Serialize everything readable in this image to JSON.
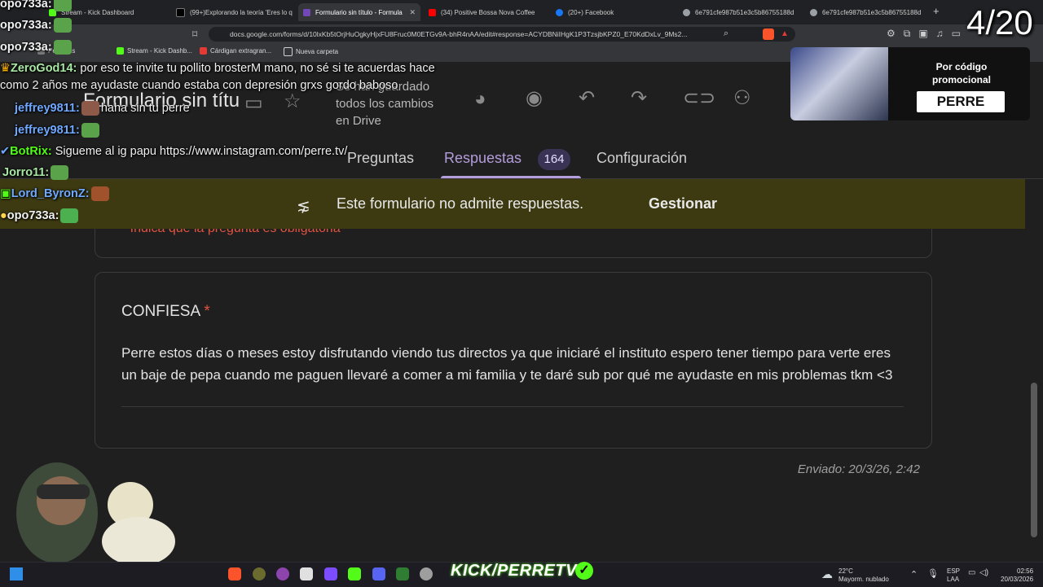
{
  "browser": {
    "tabs": [
      {
        "title": "Stream - Kick Dashboard",
        "color": "#53fc18"
      },
      {
        "title": "(99+)Explorando la teoría 'Eres lo q",
        "color": "#000000"
      },
      {
        "title": "Formulario sin título - Formula",
        "color": "#7248b9",
        "active": true
      },
      {
        "title": "(34) Positive Bossa Nova Coffee",
        "color": "#ff0000"
      },
      {
        "title": "(20+) Facebook",
        "color": "#1877f2"
      },
      {
        "title": "6e791cfe987b51e3c5b86755188d",
        "color": "#9aa0a6"
      },
      {
        "title": "6e791cfe987b51e3c5b86755188d",
        "color": "#9aa0a6"
      }
    ],
    "url": "docs.google.com/forms/d/10lxKb5tOrjHuOgkyHjxFU8Fruc0M0ETGv9A-bhR4nAA/edit#response=ACYDBNiIHgK1P3TzsjbKPZ0_E70KdDxLv_9Ms2...",
    "bookmarks": [
      {
        "label": "Perrexiss",
        "color": "#7a7a7a"
      },
      {
        "label": "Stream - Kick Dashb...",
        "color": "#53fc18"
      },
      {
        "label": "Cárdigan extragran...",
        "color": "#e53935"
      },
      {
        "label": "Nueva carpeta",
        "color": "#cfcfcf"
      }
    ]
  },
  "form": {
    "title": "Formulario sin títu",
    "save_status": "Se han guardado todos los cambios en Drive",
    "tabs": {
      "questions": "Preguntas",
      "responses": "Respuestas",
      "count": "164",
      "settings": "Configuración"
    },
    "banner": {
      "text": "Este formulario no admite respuestas.",
      "action": "Gestionar"
    },
    "required_note": "* Indica que la pregunta es obligatoria",
    "question": {
      "title": "CONFIESA",
      "required_mark": "*"
    },
    "answer": "Perre estos días o meses estoy disfrutando viendo tus directos ya que iniciaré el instituto espero tener tiempo para verte eres un baje de pepa cuando me paguen llevaré a comer a mi familia y te daré sub por qué me ayudaste en mis problemas tkm <3",
    "sent": "Enviado: 20/3/26, 2:42",
    "accent": "#b39ddb",
    "banner_color": "#3d3a12"
  },
  "overlay": {
    "counter": "4/20",
    "promo": {
      "label": "Por código promocional",
      "code": "PERRE"
    },
    "chat": [
      {
        "user": "opo733a:",
        "color": "#f0f0f0",
        "msg": ""
      },
      {
        "user": "opo733a:",
        "color": "#f0f0f0",
        "msg": ""
      },
      {
        "user": "opo733a:",
        "color": "#f0f0f0",
        "msg": ""
      },
      {
        "user": "ZeroGod14:",
        "color": "#a8e6a3",
        "msg": "por eso te invite tu pollito brosterM mano, no sé si te acuerdas hace"
      },
      {
        "user": "",
        "color": "#f0f0f0",
        "msg": "como 2 años  me ayudaste cuando estaba con depresión grxs gordo baboso"
      },
      {
        "user": "jeffrey9811:",
        "color": "#6fa8ff",
        "msg": "haha sin tu perre"
      },
      {
        "user": "jeffrey9811:",
        "color": "#6fa8ff",
        "msg": ""
      },
      {
        "user": "BotRix:",
        "color": "#53fc18",
        "msg": "Sigueme al ig papu https://www.instagram.com/perre.tv/"
      },
      {
        "user": "Jorro11:",
        "color": "#a8e6a3",
        "msg": ""
      },
      {
        "user": "Lord_ByronZ:",
        "color": "#6fa8ff",
        "msg": ""
      },
      {
        "user": "opo733a:",
        "color": "#f0f0f0",
        "msg": ""
      }
    ],
    "brand": "KICK/PERRETV"
  },
  "taskbar": {
    "weather": {
      "temp": "22°C",
      "desc": "Mayorm. nublado"
    },
    "lang": {
      "top": "ESP",
      "bottom": "LAA"
    },
    "time": "02:56",
    "date": "20/03/2026"
  }
}
